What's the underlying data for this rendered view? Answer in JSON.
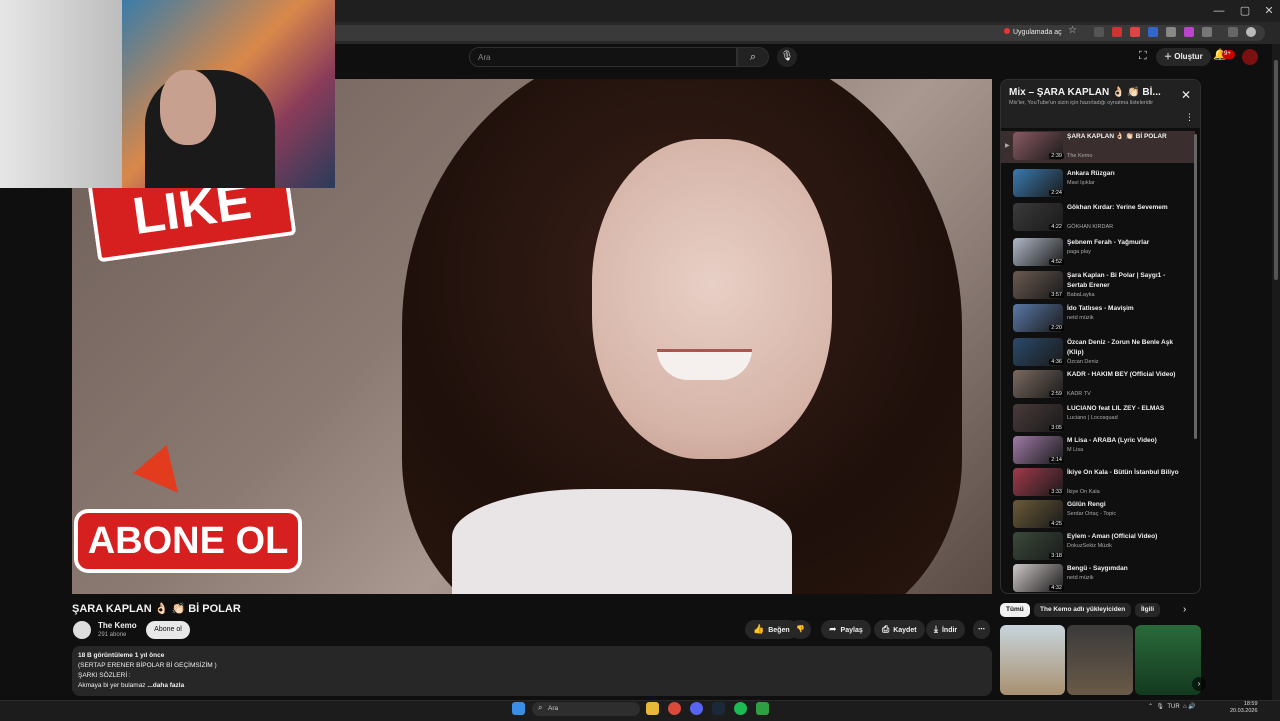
{
  "browser": {
    "open_in_app": "Uygulamada aç",
    "window_controls": [
      "—",
      "▢",
      "✕"
    ]
  },
  "header": {
    "search_placeholder": "Ara",
    "create_label": "Oluştur",
    "notif_count": "9+"
  },
  "video": {
    "like_overlay": "LIKE",
    "subscribe_overlay": "ABONE OL",
    "title": "ŞARA KAPLAN 👌🏻 👏🏻 Bİ POLAR",
    "channel": "The Kemo",
    "subscribers": "291 abone",
    "subscribe_btn": "Abone ol",
    "actions": {
      "like": "Beğen",
      "share": "Paylaş",
      "save": "Kaydet",
      "download": "İndir"
    }
  },
  "description": {
    "stats": "18 B görüntüleme  1 yıl önce",
    "line1": "(SERTAP ERENER BİPOLAR Bİ GEÇİMSİZİM )",
    "line2": "ŞARKI SÖZLERİ :",
    "line3": "Akmaya bi yer bulamaz",
    "more": "...daha fazla"
  },
  "playlist": {
    "title": "Mix – ŞARA KAPLAN 👌🏻 👏🏻 Bİ...",
    "subtitle": "Mix'ler, YouTube'un sizin için hazırladığı oynatma listeleridir",
    "items": [
      {
        "title": "ŞARA KAPLAN 👌🏻 👏🏻 Bİ POLAR",
        "channel": "The Kemo",
        "duration": "2:39",
        "color": "#8a5a62"
      },
      {
        "title": "Ankara Rüzgarı",
        "channel": "Mavi Işıklar",
        "duration": "2:24",
        "color": "#3a7ab0"
      },
      {
        "title": "Gökhan Kırdar: Yerine Sevemem",
        "channel": "GÖKHAN KIRDAR",
        "duration": "4:22",
        "color": "#3a3a3a"
      },
      {
        "title": "Şebnem Ferah - Yağmurlar",
        "channel": "paga play",
        "duration": "4:52",
        "color": "#b0b8c8"
      },
      {
        "title": "Şara Kaplan - Bi Polar | Saygı1 - Sertab Erener",
        "channel": "BabaLayka",
        "duration": "3:57",
        "color": "#6a5a50"
      },
      {
        "title": "İdo Tatlıses - Mavişim",
        "channel": "netd müzik",
        "duration": "2:20",
        "color": "#5a78a8"
      },
      {
        "title": "Özcan Deniz - Zorun Ne Benle Aşk (Klip)",
        "channel": "Özcan Deniz",
        "duration": "4:36",
        "color": "#2a4a6a"
      },
      {
        "title": "KADR - HAKIM BEY (Official Video)",
        "channel": "KADR TV",
        "duration": "2:59",
        "color": "#7a6a60"
      },
      {
        "title": "LUCIANO feat LIL ZEY - ELMAS",
        "channel": "Luciano | Locosquad",
        "duration": "3:05",
        "color": "#4a3a3a"
      },
      {
        "title": "M Lisa - ARABA (Lyric Video)",
        "channel": "M Lisa",
        "duration": "2:14",
        "color": "#a07aa8"
      },
      {
        "title": "İkiye On Kala - Bütün İstanbul Biliyo",
        "channel": "İkiye On Kala",
        "duration": "3:33",
        "color": "#a03a4a"
      },
      {
        "title": "Gülün Rengi",
        "channel": "Serdar Ortaç - Topic",
        "duration": "4:25",
        "color": "#6a5a38"
      },
      {
        "title": "Eylem - Aman (Official Video)",
        "channel": "DokuzSekiz Müzik",
        "duration": "3:18",
        "color": "#3a4a3a"
      },
      {
        "title": "Bengü - Saygımdan",
        "channel": "netd müzik",
        "duration": "4:32",
        "color": "#d0c8c8"
      }
    ]
  },
  "chips": [
    "Tümü",
    "The Kemo adlı yükleyiciden",
    "İlgili"
  ],
  "taskbar": {
    "search_placeholder": "Ara",
    "lang": "TUR",
    "time": "18:59",
    "date": "20.03.2026"
  }
}
